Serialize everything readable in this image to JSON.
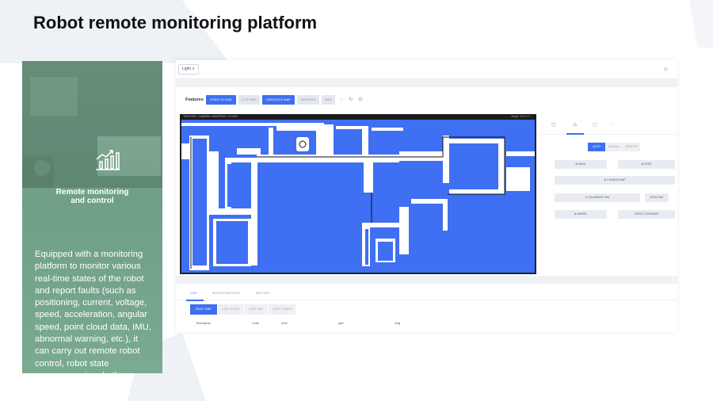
{
  "slide": {
    "title": "Robot remote monitoring platform"
  },
  "card": {
    "heading_line1": "Remote monitoring",
    "heading_line2": "and control",
    "body": "Equipped with a monitoring platform to monitor various real-time states of the robot and report faults (such as positioning, current, voltage, speed, acceleration, angular speed, point cloud data, IMU, abnormal warning, etc.), it can carry out remote robot control, robot state management and other operations.",
    "icon": "chart-hand-icon"
  },
  "app": {
    "theme_select": "Light ∨",
    "features": {
      "label": "Features",
      "buttons": [
        {
          "label": "POINT CLOUD",
          "active": true
        },
        {
          "label": "COSTMAP",
          "active": false
        },
        {
          "label": "OBSTACLE MAP",
          "active": true
        },
        {
          "label": "WAYPATH",
          "active": false
        },
        {
          "label": "SIDE",
          "active": false
        }
      ]
    },
    "map": {
      "header_left": "TRACKER / CAMERA / MAPPING / CLOUD",
      "header_right": "Zoom: 1.0   X  Y   ⛶",
      "floor_color": "#3f6ff2"
    },
    "panel": {
      "modes": [
        "AUTO",
        "MANUAL",
        "REMOTE"
      ],
      "buttons": {
        "back": "⊕ BACK",
        "stop": "⊗ STOP",
        "change_map": "⊕ CHANGE MAP",
        "calibrate": "↻ CALIBRATE IMU",
        "sync": "SYNC IMU",
        "wheel": "⊕ WHEEL",
        "reset_costmap": "RESET COSTMAP"
      }
    },
    "bottom": {
      "tabs": [
        "LOG",
        "MOTION METRICS",
        "BATTERY"
      ],
      "log_buttons": [
        "REAL TIME",
        "LAST HOUR",
        "LAST DAY",
        "LAST 3 DAYS"
      ],
      "columns": [
        "Timestamp",
        "Code",
        "level",
        "part",
        "msg"
      ]
    },
    "colors": {
      "accent": "#3d6ff0",
      "card_green": "#74a58b"
    }
  }
}
